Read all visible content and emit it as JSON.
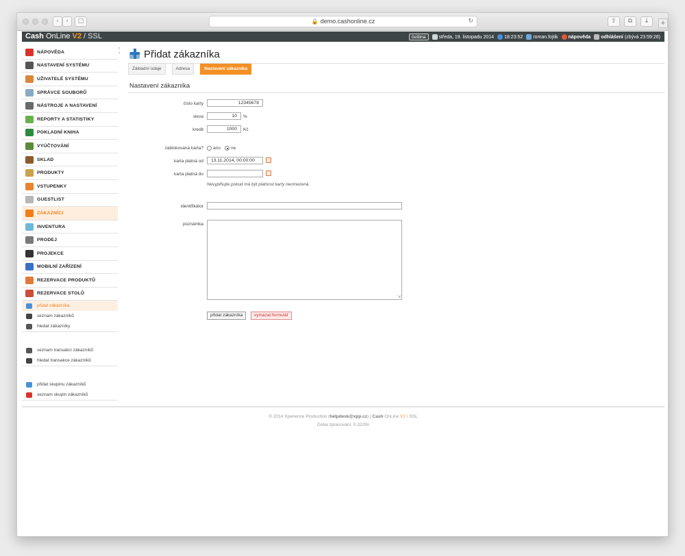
{
  "browser": {
    "url": "demo.cashonline.cz"
  },
  "app": {
    "brand_cash": "Cash",
    "brand_online": "OnLine",
    "brand_v2": "V2",
    "brand_sep": "/",
    "brand_ssl": "SSL",
    "language": "čeština",
    "date": "středa, 19. listopadu 2014",
    "time": "18:23:52",
    "user": "roman.fojtik",
    "help": "nápověda",
    "logout": "odhlášení",
    "logout_remaining": "(zbývá 23:59:28)"
  },
  "sidebar": {
    "items": [
      {
        "label": "NÁPOVĚDA",
        "color": "#d9342b"
      },
      {
        "label": "NASTAVENÍ SYSTÉMU",
        "color": "#555555"
      },
      {
        "label": "UŽIVATELÉ SYSTÉMU",
        "color": "#d8873b"
      },
      {
        "label": "SPRÁVCE SOUBORŮ",
        "color": "#8aa9c5"
      },
      {
        "label": "NÁSTROJE A NASTAVENÍ",
        "color": "#6a6a6a"
      },
      {
        "label": "REPORTY A STATISTIKY",
        "color": "#6ab04c"
      },
      {
        "label": "POKLADNÍ KNIHA",
        "color": "#2e8b3e"
      },
      {
        "label": "VYÚČTOVÁNÍ",
        "color": "#5b8a3b"
      },
      {
        "label": "SKLAD",
        "color": "#8b5a2b"
      },
      {
        "label": "PRODUKTY",
        "color": "#c9a24d"
      },
      {
        "label": "VSTUPENKY",
        "color": "#e8842e"
      },
      {
        "label": "GUESTLIST",
        "color": "#b7b7b7"
      },
      {
        "label": "ZÁKAZNÍCI",
        "color": "#f07f18"
      },
      {
        "label": "INVENTURA",
        "color": "#6fb7d9"
      },
      {
        "label": "PRODEJ",
        "color": "#7a7a7a"
      },
      {
        "label": "PROJEKCE",
        "color": "#333333"
      },
      {
        "label": "MOBILNÍ ZAŘÍZENÍ",
        "color": "#3b6fc4"
      },
      {
        "label": "REZERVACE PRODUKTŮ",
        "color": "#e07a3a"
      },
      {
        "label": "REZERVACE STOLŮ",
        "color": "#c94f3a"
      }
    ],
    "sub_group_1": [
      {
        "label": "přidat zákazníka"
      },
      {
        "label": "seznam zákazníků"
      },
      {
        "label": "hledat zákazníky"
      }
    ],
    "sub_group_2": [
      {
        "label": "seznam transakcí zákazníků"
      },
      {
        "label": "hledat transakce zákazníků"
      }
    ],
    "sub_group_3": [
      {
        "label": "přidat skupinu zákazníků"
      },
      {
        "label": "seznam skupin zákazníků"
      }
    ]
  },
  "content": {
    "page_title": "Přidat zákazníka",
    "tabs": [
      "Základní údaje",
      "Adresa",
      "Nastavení zákazníka"
    ],
    "section_title": "Nastavení zákazníka",
    "form": {
      "card_number_label": "číslo karty",
      "card_number_value": "12345678",
      "discount_label": "sleva",
      "discount_value": "10",
      "discount_unit": "%",
      "credit_label": "kredit",
      "credit_value": "1000",
      "credit_unit": "Kč",
      "blocked_label": "zablokovaná karta?",
      "blocked_yes": "ano",
      "blocked_no": "ne",
      "valid_from_label": "karta platná od",
      "valid_from_value": "13.11.2014, 00:00:00",
      "valid_to_label": "karta platná do",
      "valid_to_value": "",
      "valid_hint": "Nevyplňujte pokud má být platnost karty neomezená.",
      "identifier_label": "identifikátor",
      "identifier_value": "",
      "note_label": "poznámka",
      "note_value": "",
      "submit_label": "přidat zákazníka",
      "reset_label": "vymazat formulář"
    }
  },
  "footer": {
    "copyright": "© 2014 Xperience Production (",
    "email": "helpdesk@xpp.cz",
    "after_email": ") |",
    "cash": "Cash",
    "online": "OnLine",
    "v2": "V2",
    "ssl_part": "/ SSL",
    "processing": "Doba zpracování: 0.3229s"
  }
}
